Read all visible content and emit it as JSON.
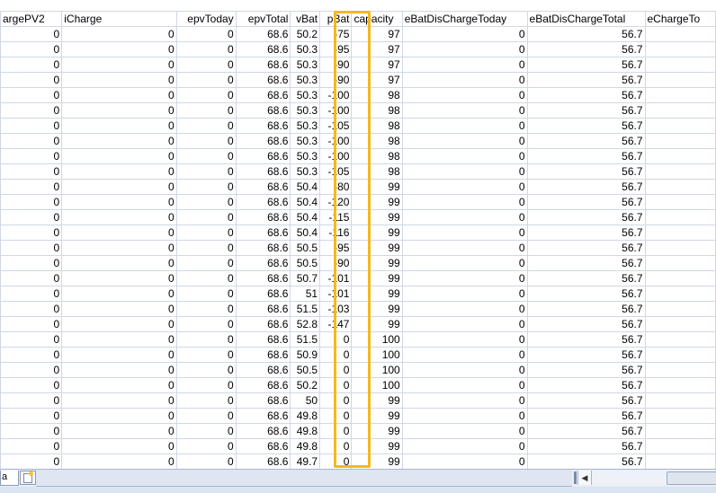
{
  "columns": [
    {
      "label": "argePV2",
      "width": 70,
      "align": "left"
    },
    {
      "label": "iCharge",
      "width": 136,
      "align": "left"
    },
    {
      "label": "epvToday",
      "width": 67,
      "align": "right"
    },
    {
      "label": "epvTotal",
      "width": 62,
      "align": "right"
    },
    {
      "label": "vBat",
      "width": 33,
      "align": "right"
    },
    {
      "label": "pBat",
      "width": 36,
      "align": "right"
    },
    {
      "label": "capacity",
      "width": 57,
      "align": "left"
    },
    {
      "label": "eBatDisChargeToday",
      "width": 141,
      "align": "left"
    },
    {
      "label": "eBatDisChargeTotal",
      "width": 133,
      "align": "left"
    },
    {
      "label": "eChargeTo",
      "width": 80,
      "align": "left"
    }
  ],
  "rows": [
    [
      "0",
      "0",
      "0",
      "68.6",
      "50.2",
      "-75",
      "97",
      "0",
      "56.7",
      ""
    ],
    [
      "0",
      "0",
      "0",
      "68.6",
      "50.3",
      "-95",
      "97",
      "0",
      "56.7",
      ""
    ],
    [
      "0",
      "0",
      "0",
      "68.6",
      "50.3",
      "-90",
      "97",
      "0",
      "56.7",
      ""
    ],
    [
      "0",
      "0",
      "0",
      "68.6",
      "50.3",
      "-90",
      "97",
      "0",
      "56.7",
      ""
    ],
    [
      "0",
      "0",
      "0",
      "68.6",
      "50.3",
      "-100",
      "98",
      "0",
      "56.7",
      ""
    ],
    [
      "0",
      "0",
      "0",
      "68.6",
      "50.3",
      "-100",
      "98",
      "0",
      "56.7",
      ""
    ],
    [
      "0",
      "0",
      "0",
      "68.6",
      "50.3",
      "-105",
      "98",
      "0",
      "56.7",
      ""
    ],
    [
      "0",
      "0",
      "0",
      "68.6",
      "50.3",
      "-100",
      "98",
      "0",
      "56.7",
      ""
    ],
    [
      "0",
      "0",
      "0",
      "68.6",
      "50.3",
      "-100",
      "98",
      "0",
      "56.7",
      ""
    ],
    [
      "0",
      "0",
      "0",
      "68.6",
      "50.3",
      "-105",
      "98",
      "0",
      "56.7",
      ""
    ],
    [
      "0",
      "0",
      "0",
      "68.6",
      "50.4",
      "-80",
      "99",
      "0",
      "56.7",
      ""
    ],
    [
      "0",
      "0",
      "0",
      "68.6",
      "50.4",
      "-120",
      "99",
      "0",
      "56.7",
      ""
    ],
    [
      "0",
      "0",
      "0",
      "68.6",
      "50.4",
      "-115",
      "99",
      "0",
      "56.7",
      ""
    ],
    [
      "0",
      "0",
      "0",
      "68.6",
      "50.4",
      "-116",
      "99",
      "0",
      "56.7",
      ""
    ],
    [
      "0",
      "0",
      "0",
      "68.6",
      "50.5",
      "-95",
      "99",
      "0",
      "56.7",
      ""
    ],
    [
      "0",
      "0",
      "0",
      "68.6",
      "50.5",
      "-90",
      "99",
      "0",
      "56.7",
      ""
    ],
    [
      "0",
      "0",
      "0",
      "68.6",
      "50.7",
      "-101",
      "99",
      "0",
      "56.7",
      ""
    ],
    [
      "0",
      "0",
      "0",
      "68.6",
      "51",
      "-101",
      "99",
      "0",
      "56.7",
      ""
    ],
    [
      "0",
      "0",
      "0",
      "68.6",
      "51.5",
      "-103",
      "99",
      "0",
      "56.7",
      ""
    ],
    [
      "0",
      "0",
      "0",
      "68.6",
      "52.8",
      "-147",
      "99",
      "0",
      "56.7",
      ""
    ],
    [
      "0",
      "0",
      "0",
      "68.6",
      "51.5",
      "0",
      "100",
      "0",
      "56.7",
      ""
    ],
    [
      "0",
      "0",
      "0",
      "68.6",
      "50.9",
      "0",
      "100",
      "0",
      "56.7",
      ""
    ],
    [
      "0",
      "0",
      "0",
      "68.6",
      "50.5",
      "0",
      "100",
      "0",
      "56.7",
      ""
    ],
    [
      "0",
      "0",
      "0",
      "68.6",
      "50.2",
      "0",
      "100",
      "0",
      "56.7",
      ""
    ],
    [
      "0",
      "0",
      "0",
      "68.6",
      "50",
      "0",
      "99",
      "0",
      "56.7",
      ""
    ],
    [
      "0",
      "0",
      "0",
      "68.6",
      "49.8",
      "0",
      "99",
      "0",
      "56.7",
      ""
    ],
    [
      "0",
      "0",
      "0",
      "68.6",
      "49.8",
      "0",
      "99",
      "0",
      "56.7",
      ""
    ],
    [
      "0",
      "0",
      "0",
      "68.6",
      "49.8",
      "0",
      "99",
      "0",
      "56.7",
      ""
    ],
    [
      "0",
      "0",
      "0",
      "68.6",
      "49.7",
      "0",
      "99",
      "0",
      "56.7",
      ""
    ]
  ],
  "sheet_tab_fragment": "a",
  "highlight_color": "#f5b81c",
  "grid_line_color": "#d0d7e5"
}
